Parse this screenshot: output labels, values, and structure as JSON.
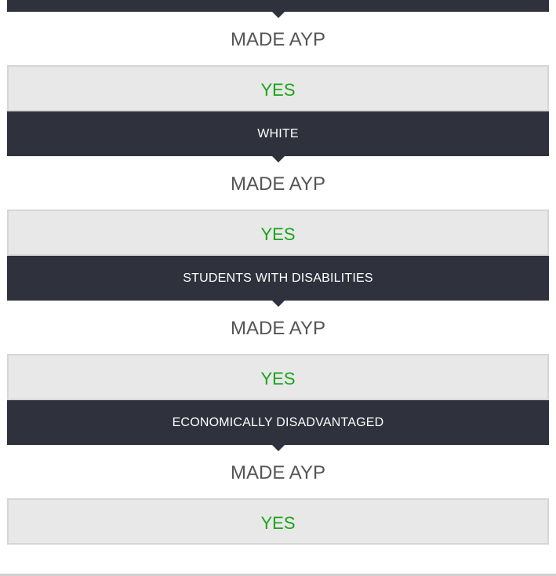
{
  "groups": [
    {
      "header": "",
      "status_label": "MADE AYP",
      "result": "YES"
    },
    {
      "header": "WHITE",
      "status_label": "MADE AYP",
      "result": "YES"
    },
    {
      "header": "STUDENTS WITH DISABILITIES",
      "status_label": "MADE AYP",
      "result": "YES"
    },
    {
      "header": "ECONOMICALLY DISADVANTAGED",
      "status_label": "MADE AYP",
      "result": "YES"
    }
  ],
  "colors": {
    "header_bg": "#2f323d",
    "result_text": "#1aa51a",
    "result_bg": "#e8e8e8"
  }
}
